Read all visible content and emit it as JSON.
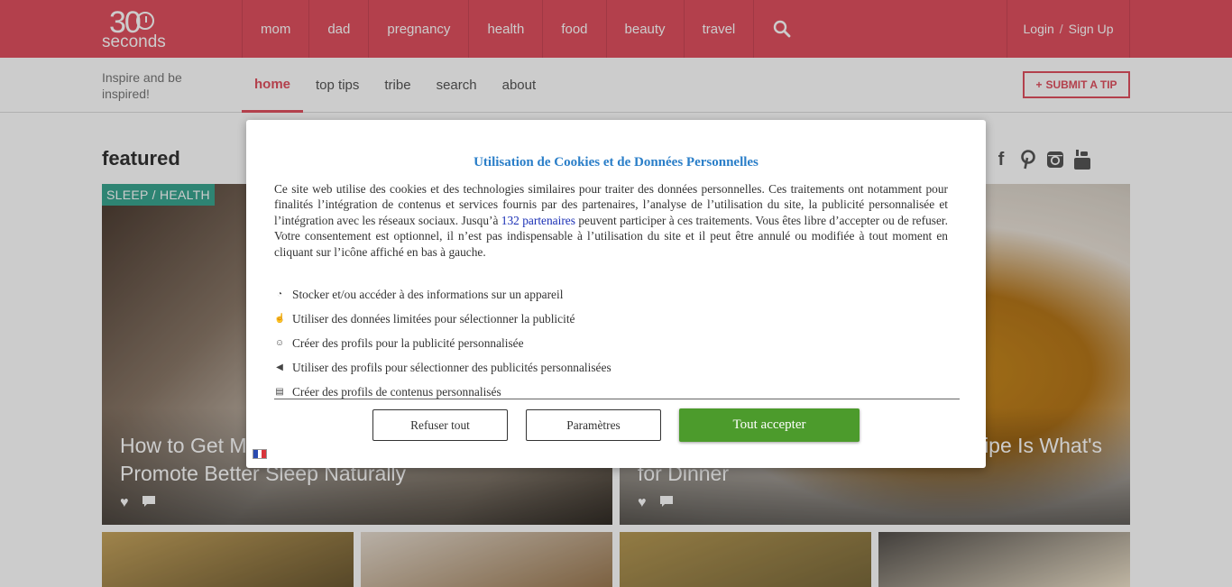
{
  "brand": {
    "number": "30",
    "word": "seconds",
    "tagline": "Inspire and be inspired!"
  },
  "main_nav": [
    "mom",
    "dad",
    "pregnancy",
    "health",
    "food",
    "beauty",
    "travel"
  ],
  "auth": {
    "login": "Login",
    "separator": "/",
    "signup": "Sign Up"
  },
  "sub_nav": {
    "items": [
      "home",
      "top tips",
      "tribe",
      "search",
      "about"
    ],
    "active": "home"
  },
  "submit_tip": "SUBMIT A TIP",
  "featured_title": "featured",
  "social_icons": [
    "facebook-icon",
    "pinterest-icon",
    "instagram-icon",
    "youtube-icon"
  ],
  "cards": [
    {
      "tag": "SLEEP / HEALTH",
      "title": "How to Get Mo… Promote Better Sleep Naturally",
      "title_line1": "How to Get Mo",
      "title_line2": "Promote Better Sleep Naturally"
    },
    {
      "tag": "",
      "title_line1": "ipe Is What's",
      "title_line2": "for Dinner"
    }
  ],
  "colors": {
    "brand_red": "#e0505f",
    "teal_tag": "#3aa690",
    "accept_green": "#4c9b2c",
    "title_blue": "#2a7ec8"
  },
  "cookie_modal": {
    "title": "Utilisation de Cookies et de Données Personnelles",
    "text_before_link": "Ce site web utilise des cookies et des technologies similaires pour traiter des données personnelles. Ces traitements ont notamment pour finalités l’intégration de contenus et services fournis par des partenaires, l’analyse de l’utilisation du site, la publicité personnalisée et l’intégration avec les réseaux sociaux. Jusqu’à ",
    "link_text": "132 partenaires",
    "text_after_link": " peuvent participer à ces traitements. Vous êtes libre d’accepter ou de refuser. Votre consentement est optionnel, il n’est pas indispensable à l’utilisation du site et il peut être annulé ou modifiée à tout moment en cliquant sur l’icône affiché en bas à gauche.",
    "purposes": [
      "Stocker et/ou accéder à des informations sur un appareil",
      "Utiliser des données limitées pour sélectionner la publicité",
      "Créer des profils pour la publicité personnalisée",
      "Utiliser des profils pour sélectionner des publicités personnalisées",
      "Créer des profils de contenus personnalisés"
    ],
    "buttons": {
      "refuse": "Refuser tout",
      "params": "Paramètres",
      "accept": "Tout accepter"
    }
  }
}
